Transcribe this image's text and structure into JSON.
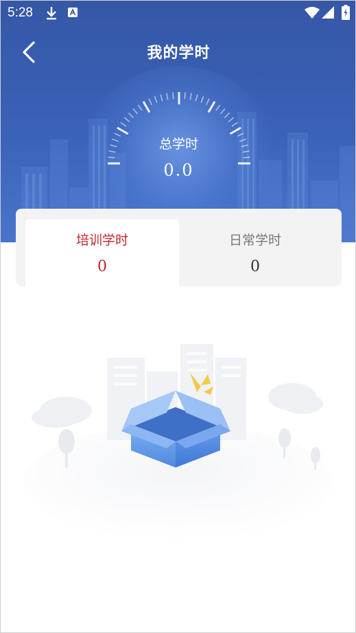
{
  "statusbar": {
    "time": "5:28",
    "icons": [
      "download-icon",
      "a-icon",
      "wifi-icon",
      "signal-icon",
      "battery-icon"
    ]
  },
  "header": {
    "title": "我的学时",
    "back_icon": "chevron-left-icon"
  },
  "summary": {
    "total_label": "总学时",
    "total_value": "0.0"
  },
  "tabs": [
    {
      "label": "培训学时",
      "value": "0",
      "active": true
    },
    {
      "label": "日常学时",
      "value": "0",
      "active": false
    }
  ],
  "empty_state": {
    "illustration": "empty-box-illustration"
  },
  "colors": {
    "header_blue": "#3a62b8",
    "active_red": "#c0262d",
    "card_bg": "#f3f3f3"
  }
}
